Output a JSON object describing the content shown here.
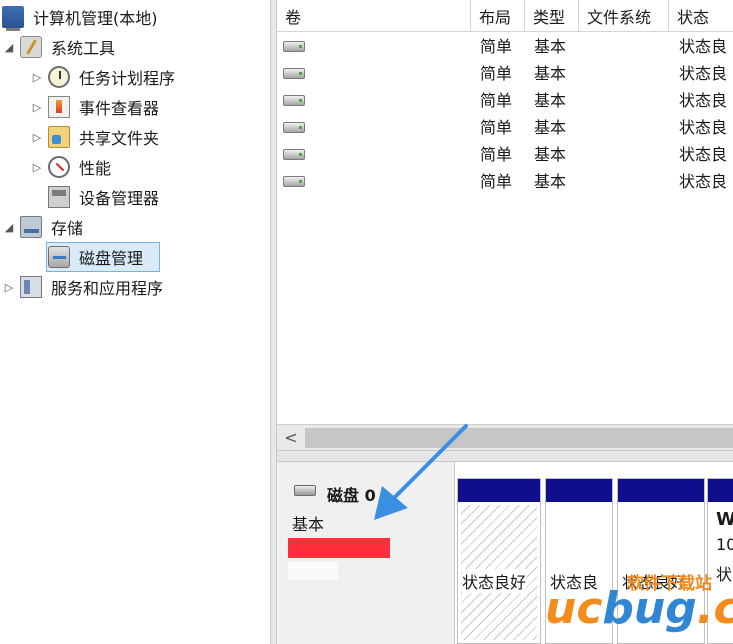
{
  "tree": {
    "root_label": "计算机管理(本地)",
    "items": [
      {
        "label": "系统工具",
        "level": 1,
        "expander": "collapse",
        "icon": "tools-icon"
      },
      {
        "label": "任务计划程序",
        "level": 2,
        "expander": "expand",
        "icon": "clock-icon"
      },
      {
        "label": "事件查看器",
        "level": 2,
        "expander": "expand",
        "icon": "event-viewer-icon"
      },
      {
        "label": "共享文件夹",
        "level": 2,
        "expander": "expand",
        "icon": "shared-folder-icon"
      },
      {
        "label": "性能",
        "level": 2,
        "expander": "expand",
        "icon": "performance-icon"
      },
      {
        "label": "设备管理器",
        "level": 2,
        "expander": "none",
        "icon": "device-manager-icon"
      },
      {
        "label": "存储",
        "level": 1,
        "expander": "collapse",
        "icon": "storage-icon"
      },
      {
        "label": "磁盘管理",
        "level": 2,
        "expander": "none",
        "icon": "disk-management-icon",
        "selected": true
      },
      {
        "label": "服务和应用程序",
        "level": 1,
        "expander": "expand",
        "icon": "services-icon"
      }
    ]
  },
  "volume_list": {
    "columns": [
      "卷",
      "布局",
      "类型",
      "文件系统",
      "状态"
    ],
    "rows": [
      {
        "layout": "简单",
        "type": "基本",
        "status": "状态良"
      },
      {
        "layout": "简单",
        "type": "基本",
        "status": "状态良"
      },
      {
        "layout": "简单",
        "type": "基本",
        "status": "状态良"
      },
      {
        "layout": "简单",
        "type": "基本",
        "status": "状态良"
      },
      {
        "layout": "简单",
        "type": "基本",
        "status": "状态良"
      },
      {
        "layout": "简单",
        "type": "基本",
        "status": "状态良"
      }
    ],
    "scroll_left_glyph": "<"
  },
  "disk": {
    "name": "磁盘 0",
    "type": "基本",
    "partitions": [
      {
        "status": "状态良好",
        "hatched": true
      },
      {
        "status": "状态良",
        "hatched": false
      },
      {
        "status": "状态良好",
        "hatched": false
      },
      {
        "big": "W",
        "line2": "10",
        "line3": "状",
        "hatched": false
      }
    ]
  },
  "watermark": {
    "top_text": "软件下载站",
    "brand_u": "uc",
    "brand_b": "bug",
    "brand_tail": ".cc"
  },
  "colors": {
    "partition_bar": "#0f0f8e",
    "selection": "#d9ebf9",
    "redaction": "#fd2f3b",
    "arrow": "#3b8fe0"
  }
}
